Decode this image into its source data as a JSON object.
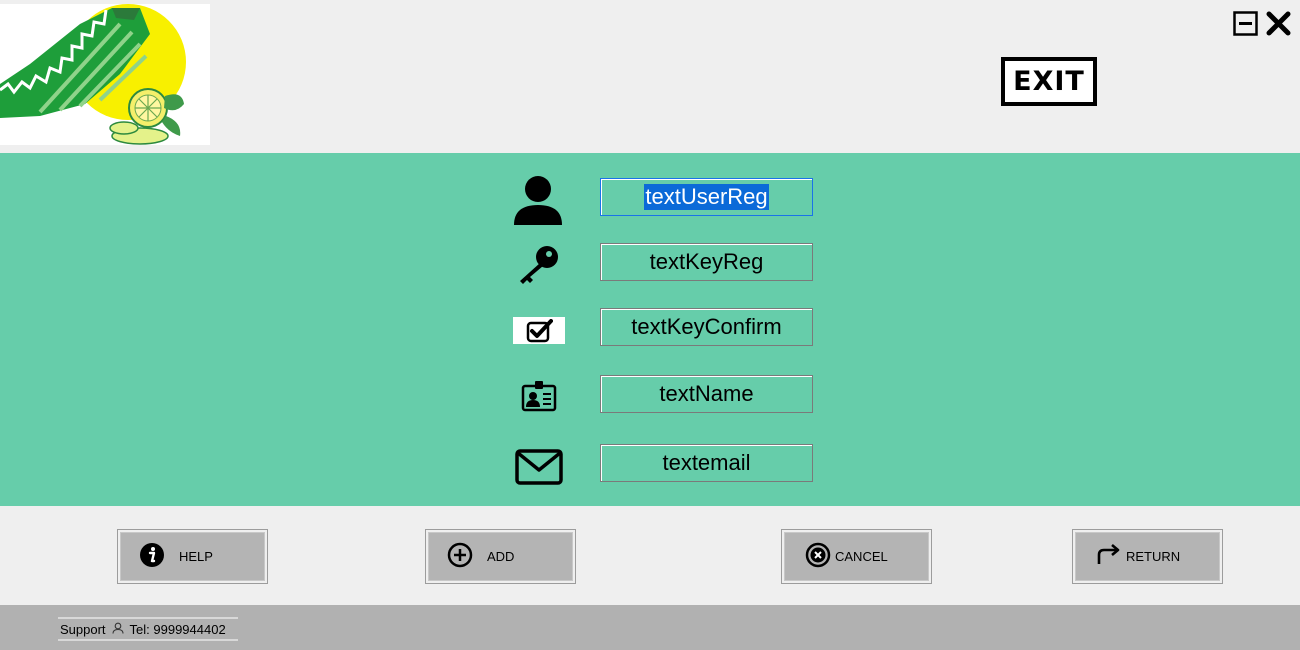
{
  "header": {
    "logo_icon": "lemon-logo-icon",
    "exit_label": "EXIT",
    "minimize_icon": "minimize-icon",
    "close_icon": "close-icon"
  },
  "form": {
    "user": {
      "value": "textUserReg",
      "icon": "user-icon"
    },
    "key": {
      "value": "textKeyReg",
      "icon": "key-icon"
    },
    "key_confirm": {
      "value": "textKeyConfirm",
      "icon": "checkbox-icon"
    },
    "name": {
      "value": "textName",
      "icon": "id-card-icon"
    },
    "email": {
      "value": "textemail",
      "icon": "envelope-icon"
    }
  },
  "actions": {
    "help": {
      "label": "HELP",
      "icon": "info-icon"
    },
    "add": {
      "label": "ADD",
      "icon": "plus-circle-icon"
    },
    "cancel": {
      "label": "CANCEL",
      "icon": "x-circle-icon"
    },
    "return": {
      "label": "RETURN",
      "icon": "return-arrow-icon"
    }
  },
  "footer": {
    "support_label": "Support",
    "support_icon": "person-icon",
    "phone": "Tel: 9999944402"
  },
  "colors": {
    "form_band": "#66cdaa",
    "background": "#efefef",
    "button": "#b4b4b4",
    "footer": "#b1b1b1",
    "selection": "#0b6ad8"
  }
}
